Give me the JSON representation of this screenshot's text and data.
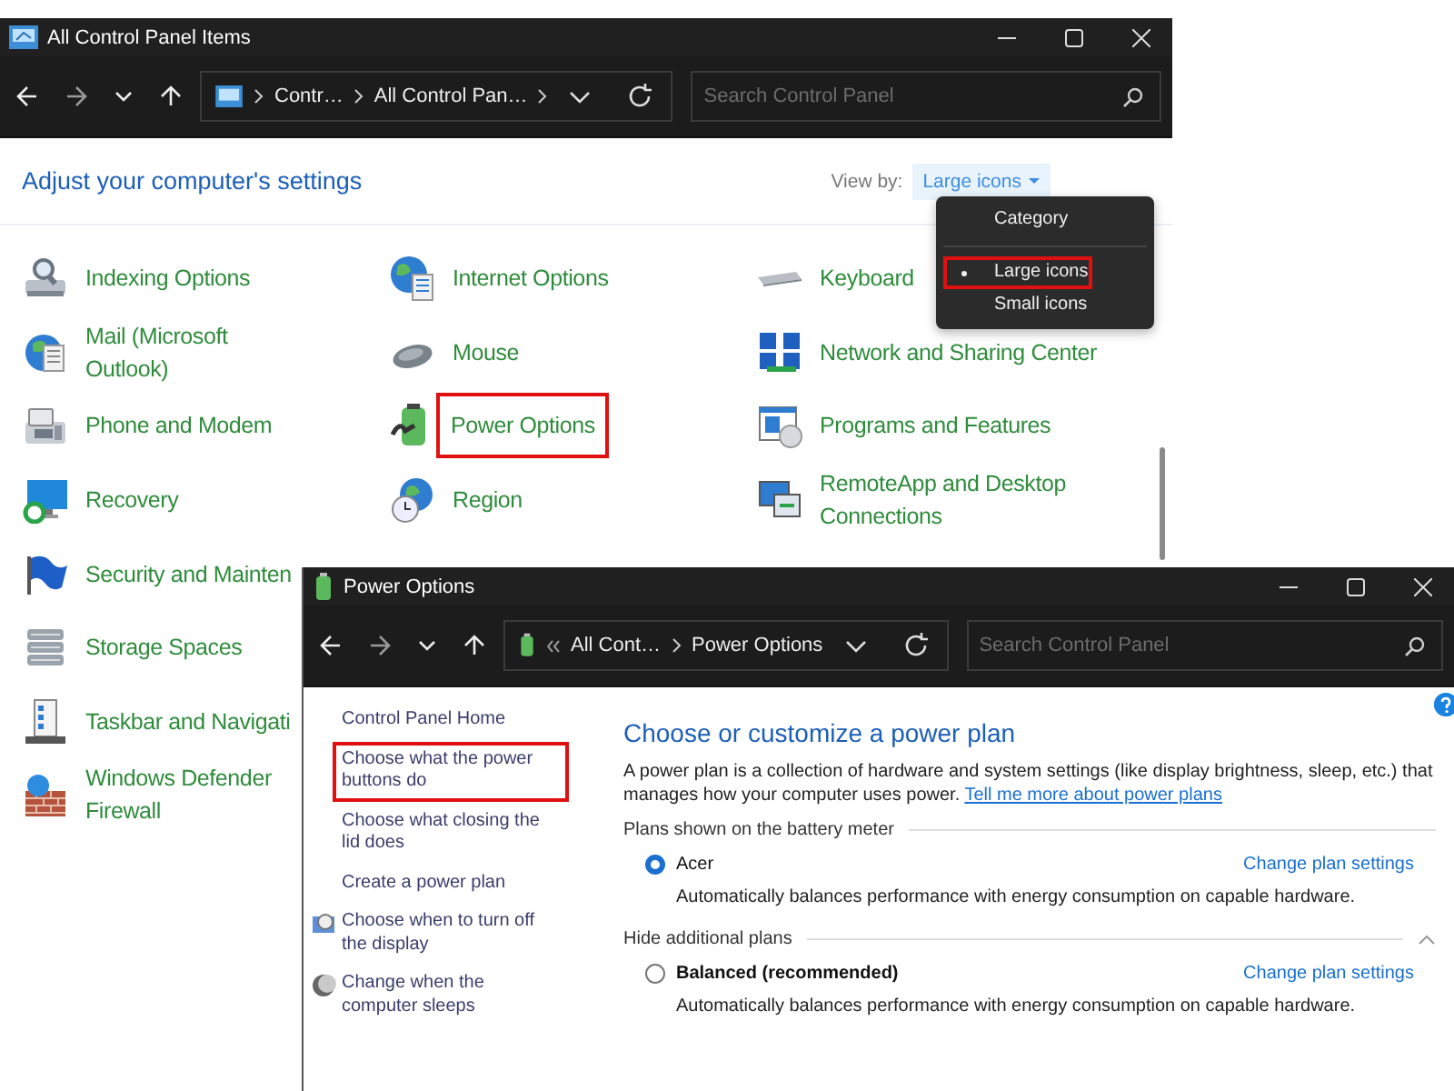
{
  "back_window": {
    "title": "All Control Panel Items",
    "breadcrumb": [
      "Contr…",
      "All Control Pan…"
    ],
    "search": {
      "placeholder": "Search Control Panel"
    },
    "heading": "Adjust your computer's settings",
    "view_by": {
      "label": "View by:",
      "value": "Large icons",
      "menu": [
        {
          "label": "Category",
          "selected": false,
          "highlighted": false
        },
        {
          "label": "Large icons",
          "selected": true,
          "highlighted": true
        },
        {
          "label": "Small icons",
          "selected": false,
          "highlighted": false
        }
      ]
    },
    "columns": [
      [
        {
          "label": "Indexing Options",
          "kind": "indexing",
          "highlighted": false
        },
        {
          "label": "Mail (Microsoft Outlook)",
          "kind": "mail",
          "highlighted": false
        },
        {
          "label": "Phone and Modem",
          "kind": "phone",
          "highlighted": false
        },
        {
          "label": "Recovery",
          "kind": "recovery",
          "highlighted": false
        },
        {
          "label": "Security and Mainten",
          "kind": "security",
          "highlighted": false
        },
        {
          "label": "Storage Spaces",
          "kind": "storage",
          "highlighted": false
        },
        {
          "label": "Taskbar and Navigati",
          "kind": "taskbar",
          "highlighted": false
        },
        {
          "label": "Windows Defender Firewall",
          "kind": "firewall",
          "highlighted": false
        }
      ],
      [
        {
          "label": "Internet Options",
          "kind": "internet",
          "highlighted": false
        },
        {
          "label": "Mouse",
          "kind": "mouse",
          "highlighted": false
        },
        {
          "label": "Power Options",
          "kind": "power",
          "highlighted": true
        },
        {
          "label": "Region",
          "kind": "region",
          "highlighted": false
        }
      ],
      [
        {
          "label": "Keyboard",
          "kind": "keyboard",
          "highlighted": false
        },
        {
          "label": "Network and Sharing Center",
          "kind": "network",
          "highlighted": false
        },
        {
          "label": "Programs and Features",
          "kind": "programs",
          "highlighted": false
        },
        {
          "label": "RemoteApp and Desktop Connections",
          "kind": "remote",
          "highlighted": false
        }
      ]
    ]
  },
  "front_window": {
    "title": "Power Options",
    "breadcrumb": [
      "All Cont…",
      "Power Options"
    ],
    "search": {
      "placeholder": "Search Control Panel"
    },
    "sidebar": [
      {
        "label": "Control Panel Home",
        "kind": "plain",
        "highlighted": false
      },
      {
        "label": "Choose what the power buttons do",
        "kind": "plain",
        "highlighted": true
      },
      {
        "label": "Choose what closing the lid does",
        "kind": "plain",
        "highlighted": false
      },
      {
        "label": "Create a power plan",
        "kind": "plain",
        "highlighted": false
      },
      {
        "label": "Choose when to turn off the display",
        "kind": "display",
        "highlighted": false
      },
      {
        "label": "Change when the computer sleeps",
        "kind": "sleep",
        "highlighted": false
      }
    ],
    "heading": "Choose or customize a power plan",
    "description": "A power plan is a collection of hardware and system settings (like display brightness, sleep, etc.) that manages how your computer uses power.",
    "description_link": "Tell me more about power plans",
    "groups": [
      {
        "title": "Plans shown on the battery meter",
        "collapsible": false,
        "plans": [
          {
            "name": "Acer",
            "selected": true,
            "bold": false,
            "link": "Change plan settings",
            "description": "Automatically balances performance with energy consumption on capable hardware."
          }
        ]
      },
      {
        "title": "Hide additional plans",
        "collapsible": true,
        "plans": [
          {
            "name": "Balanced (recommended)",
            "selected": false,
            "bold": true,
            "link": "Change plan settings",
            "description": "Automatically balances performance with energy consumption on capable hardware."
          }
        ]
      }
    ]
  }
}
